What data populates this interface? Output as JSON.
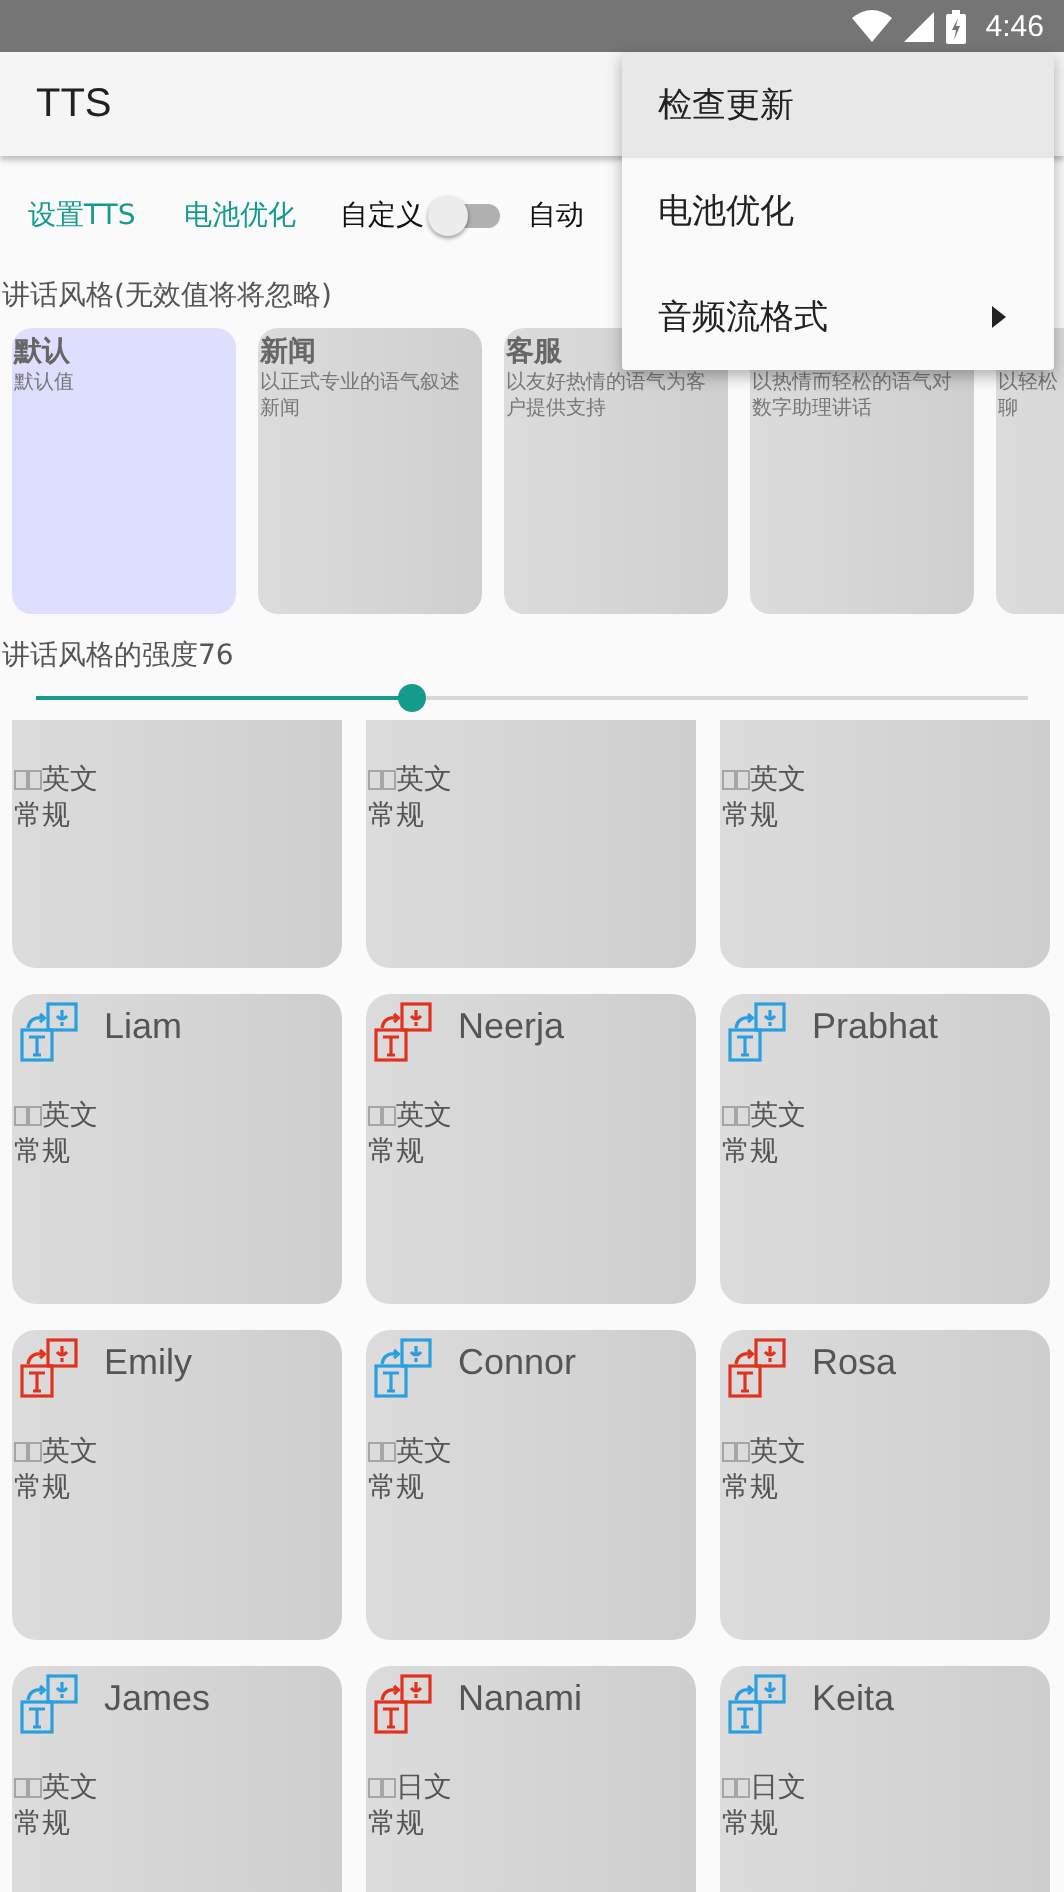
{
  "status_bar": {
    "time": "4:46"
  },
  "app_bar": {
    "title": "TTS"
  },
  "actions": [
    {
      "kind": "link",
      "label": "设置TTS"
    },
    {
      "kind": "link",
      "label": "电池优化"
    },
    {
      "kind": "switch",
      "label": "自定义",
      "on": false
    },
    {
      "kind": "text",
      "label": "自动"
    }
  ],
  "styles_label": "讲话风格(无效值将将忽略)",
  "styles": [
    {
      "title": "默认",
      "desc_lines": [
        "默认值"
      ],
      "selected": true
    },
    {
      "title": "新闻",
      "desc_lines": [
        "以正式专业的语气叙述",
        "新闻"
      ],
      "selected": false
    },
    {
      "title": "客服",
      "desc_lines": [
        "以友好热情的语气为客",
        "户提供支持"
      ],
      "selected": false
    },
    {
      "desc_lines": [
        "以热情而轻松的语气对",
        "数字助理讲话"
      ],
      "selected": false
    },
    {
      "desc_lines": [
        "以轻松",
        "聊"
      ],
      "selected": false
    }
  ],
  "intensity": {
    "label": "讲话风格的强度76",
    "level": 0.38
  },
  "voices": [
    {
      "lang": "英文",
      "style": "常规"
    },
    {
      "lang": "英文",
      "style": "常规"
    },
    {
      "lang": "英文",
      "style": "常规"
    },
    {
      "name": "Liam",
      "lang": "英文",
      "style": "常规",
      "color": "#2a9fe0"
    },
    {
      "name": "Neerja",
      "lang": "英文",
      "style": "常规",
      "color": "#e0321e"
    },
    {
      "name": "Prabhat",
      "lang": "英文",
      "style": "常规",
      "color": "#2a9fe0"
    },
    {
      "name": "Emily",
      "lang": "英文",
      "style": "常规",
      "color": "#e0321e"
    },
    {
      "name": "Connor",
      "lang": "英文",
      "style": "常规",
      "color": "#2a9fe0"
    },
    {
      "name": "Rosa",
      "lang": "英文",
      "style": "常规",
      "color": "#e0321e"
    },
    {
      "name": "James",
      "lang": "英文",
      "style": "常规",
      "color": "#2a9fe0"
    },
    {
      "name": "Nanami",
      "lang": "日文",
      "style": "常规",
      "color": "#e0321e"
    },
    {
      "name": "Keita",
      "lang": "日文",
      "style": "常规",
      "color": "#2a9fe0"
    }
  ],
  "menu": [
    {
      "label": "检查更新",
      "selected": true,
      "has_submenu": false
    },
    {
      "label": "电池优化",
      "selected": false,
      "has_submenu": false
    },
    {
      "label": "音频流格式",
      "selected": false,
      "has_submenu": true
    }
  ]
}
